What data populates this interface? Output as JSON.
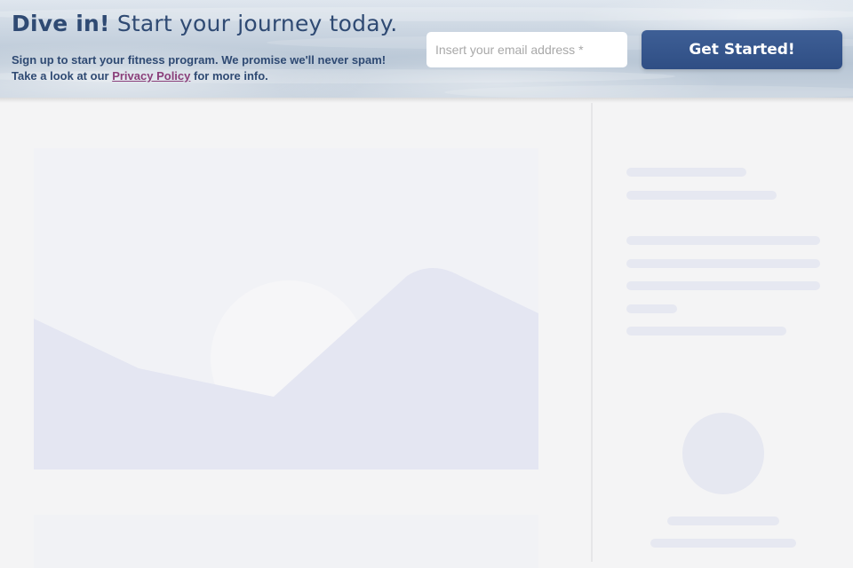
{
  "banner": {
    "headline_bold": "Dive in!",
    "headline_rest": "Start your journey today.",
    "line1": "Sign up to start your fitness program. We promise we'll never spam!",
    "line2_prefix": "Take a look at our",
    "privacy_link": "Privacy Policy",
    "line2_suffix": "for more info.",
    "email_placeholder": "Insert your email address *",
    "cta_label": "Get Started!"
  },
  "colors": {
    "brand_text": "#2f4a73",
    "cta_background": "#2f4e84",
    "link": "#8a3f7a",
    "skeleton": "#e6e8f1"
  }
}
